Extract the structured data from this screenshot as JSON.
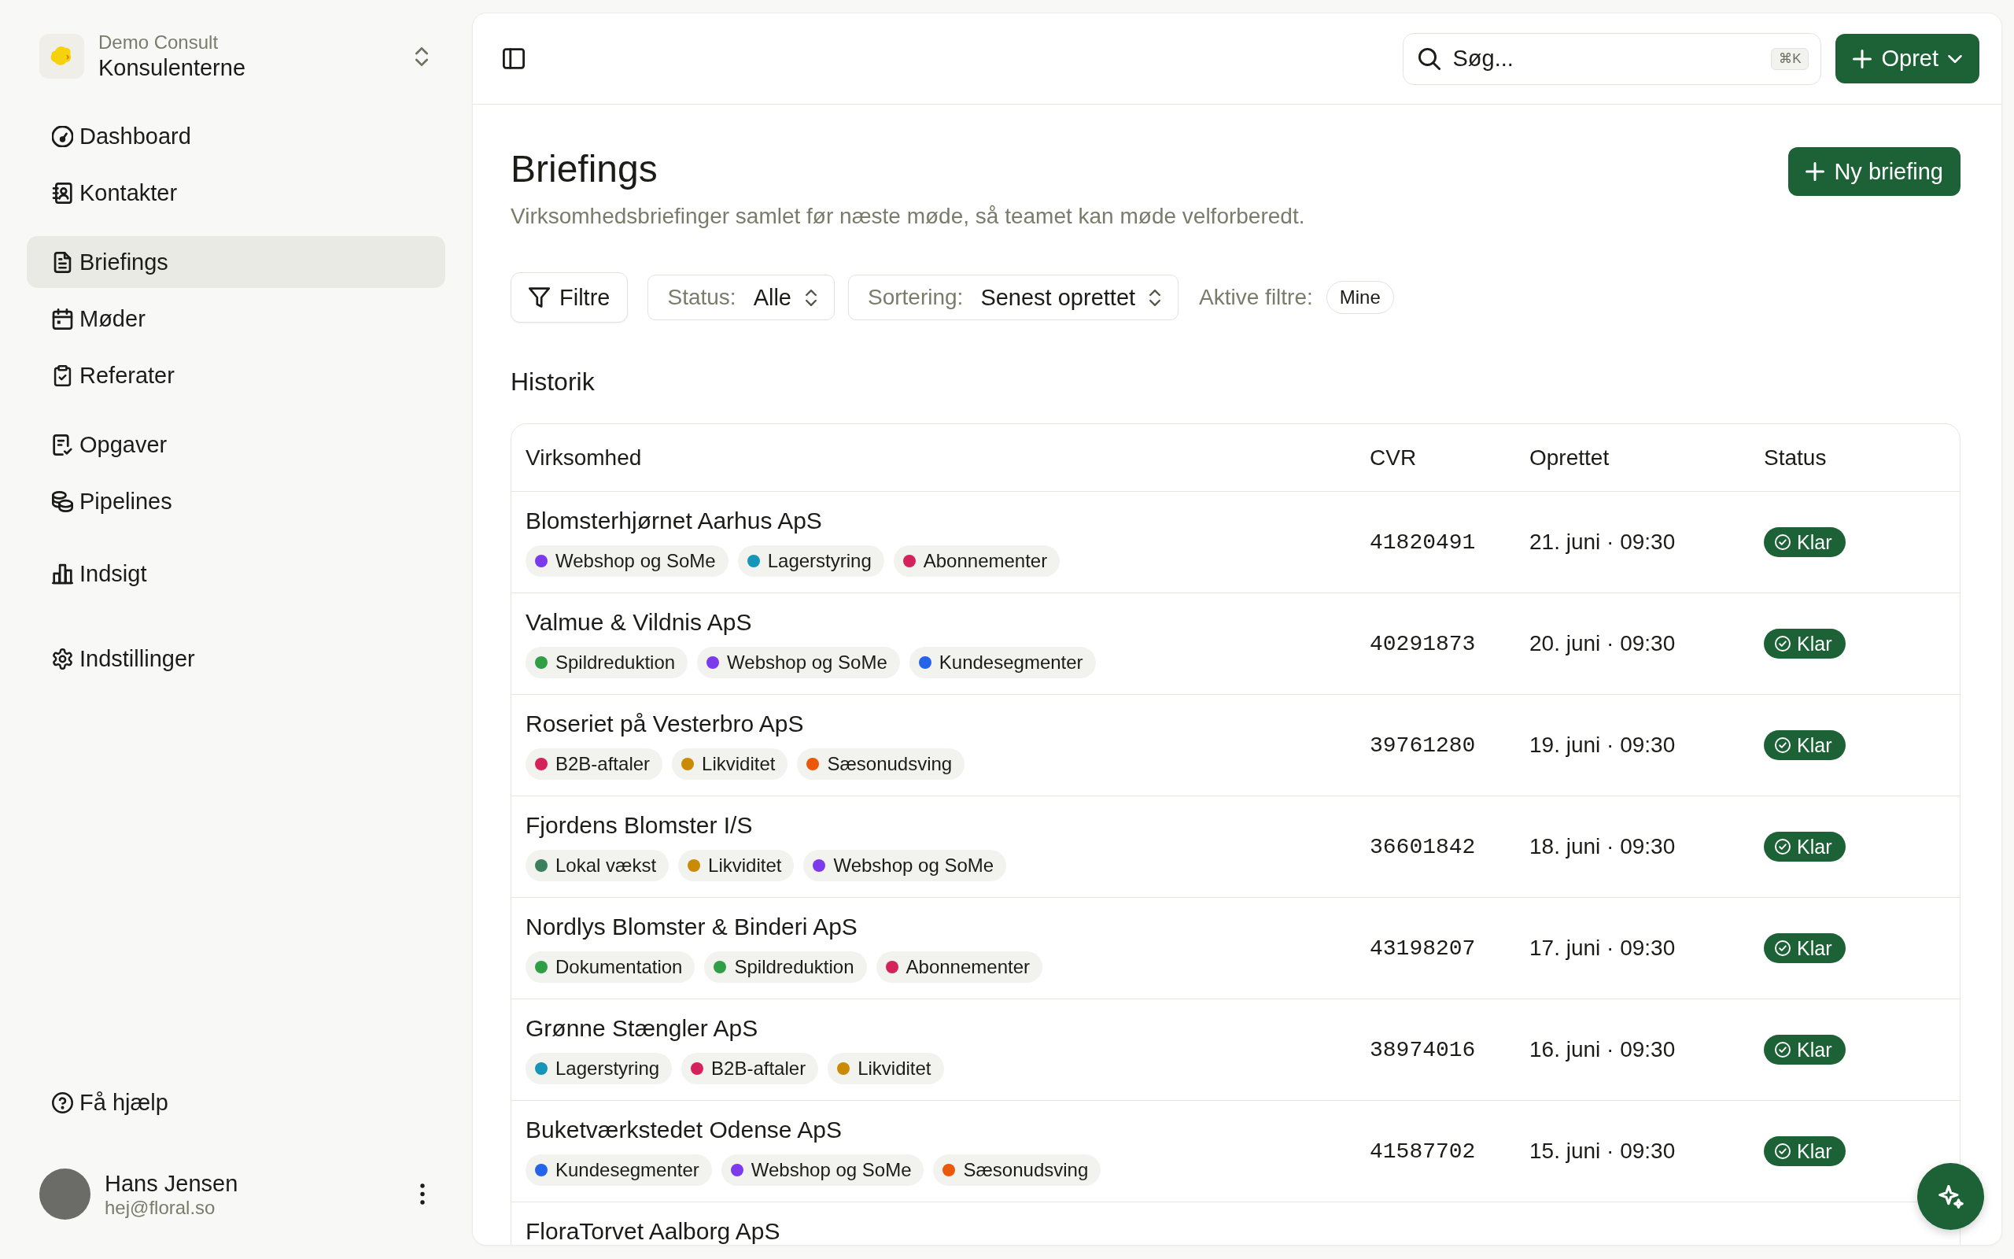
{
  "workspace": {
    "org": "Demo Consult",
    "name": "Konsulenterne"
  },
  "sidebar": {
    "groups": [
      {
        "items": [
          {
            "label": "Dashboard",
            "kind": "dashboard",
            "selected": false
          },
          {
            "label": "Kontakter",
            "kind": "contacts",
            "selected": false
          }
        ]
      },
      {
        "items": [
          {
            "label": "Briefings",
            "kind": "document",
            "selected": true
          },
          {
            "label": "Møder",
            "kind": "calendar",
            "selected": false
          },
          {
            "label": "Referater",
            "kind": "clipboard",
            "selected": false
          }
        ]
      },
      {
        "items": [
          {
            "label": "Opgaver",
            "kind": "tasks",
            "selected": false
          },
          {
            "label": "Pipelines",
            "kind": "coins",
            "selected": false
          }
        ]
      },
      {
        "items": [
          {
            "label": "Indsigt",
            "kind": "chart",
            "selected": false
          }
        ]
      },
      {
        "items": [
          {
            "label": "Indstillinger",
            "kind": "settings",
            "selected": false
          }
        ]
      }
    ],
    "help": {
      "label": "Få hjælp"
    },
    "user": {
      "name": "Hans Jensen",
      "email": "hej@floral.so"
    }
  },
  "topbar": {
    "search": {
      "placeholder": "Søg...",
      "shortcut": "⌘K"
    },
    "create_button": "Opret"
  },
  "page": {
    "title": "Briefings",
    "subtitle": "Virksomhedsbriefinger samlet før næste møde, så teamet kan møde velforberedt.",
    "new_button": "Ny briefing"
  },
  "filters": {
    "filter_button": "Filtre",
    "status": {
      "label": "Status:",
      "value": "Alle"
    },
    "sort": {
      "label": "Sortering:",
      "value": "Senest oprettet"
    },
    "active_label": "Aktive filtre:",
    "active_chips": [
      "Mine"
    ]
  },
  "section_title": "Historik",
  "table": {
    "columns": [
      "Virksomhed",
      "CVR",
      "Oprettet",
      "Status"
    ],
    "rows": [
      {
        "company": "Blomsterhjørnet Aarhus ApS",
        "tags": [
          {
            "label": "Webshop og SoMe",
            "color": "#7c3aed"
          },
          {
            "label": "Lagerstyring",
            "color": "#1596b8"
          },
          {
            "label": "Abonnementer",
            "color": "#d4225c"
          }
        ],
        "cvr": "41820491",
        "created": "21. juni · 09:30",
        "status": "Klar"
      },
      {
        "company": "Valmue & Vildnis ApS",
        "tags": [
          {
            "label": "Spildreduktion",
            "color": "#2f9e44"
          },
          {
            "label": "Webshop og SoMe",
            "color": "#7c3aed"
          },
          {
            "label": "Kundesegmenter",
            "color": "#2563eb"
          }
        ],
        "cvr": "40291873",
        "created": "20. juni · 09:30",
        "status": "Klar"
      },
      {
        "company": "Roseriet på Vesterbro ApS",
        "tags": [
          {
            "label": "B2B-aftaler",
            "color": "#d4225c"
          },
          {
            "label": "Likviditet",
            "color": "#ca8a04"
          },
          {
            "label": "Sæsonudsving",
            "color": "#ea580c"
          }
        ],
        "cvr": "39761280",
        "created": "19. juni · 09:30",
        "status": "Klar"
      },
      {
        "company": "Fjordens Blomster I/S",
        "tags": [
          {
            "label": "Lokal vækst",
            "color": "#3b7f5e"
          },
          {
            "label": "Likviditet",
            "color": "#ca8a04"
          },
          {
            "label": "Webshop og SoMe",
            "color": "#7c3aed"
          }
        ],
        "cvr": "36601842",
        "created": "18. juni · 09:30",
        "status": "Klar"
      },
      {
        "company": "Nordlys Blomster & Binderi ApS",
        "tags": [
          {
            "label": "Dokumentation",
            "color": "#2f9e44"
          },
          {
            "label": "Spildreduktion",
            "color": "#2f9e44"
          },
          {
            "label": "Abonnementer",
            "color": "#d4225c"
          }
        ],
        "cvr": "43198207",
        "created": "17. juni · 09:30",
        "status": "Klar"
      },
      {
        "company": "Grønne Stængler ApS",
        "tags": [
          {
            "label": "Lagerstyring",
            "color": "#1596b8"
          },
          {
            "label": "B2B-aftaler",
            "color": "#d4225c"
          },
          {
            "label": "Likviditet",
            "color": "#ca8a04"
          }
        ],
        "cvr": "38974016",
        "created": "16. juni · 09:30",
        "status": "Klar"
      },
      {
        "company": "Buketværkstedet Odense ApS",
        "tags": [
          {
            "label": "Kundesegmenter",
            "color": "#2563eb"
          },
          {
            "label": "Webshop og SoMe",
            "color": "#7c3aed"
          },
          {
            "label": "Sæsonudsving",
            "color": "#ea580c"
          }
        ],
        "cvr": "41587702",
        "created": "15. juni · 09:30",
        "status": "Klar"
      },
      {
        "company": "FloraTorvet Aalborg ApS"
      }
    ]
  }
}
